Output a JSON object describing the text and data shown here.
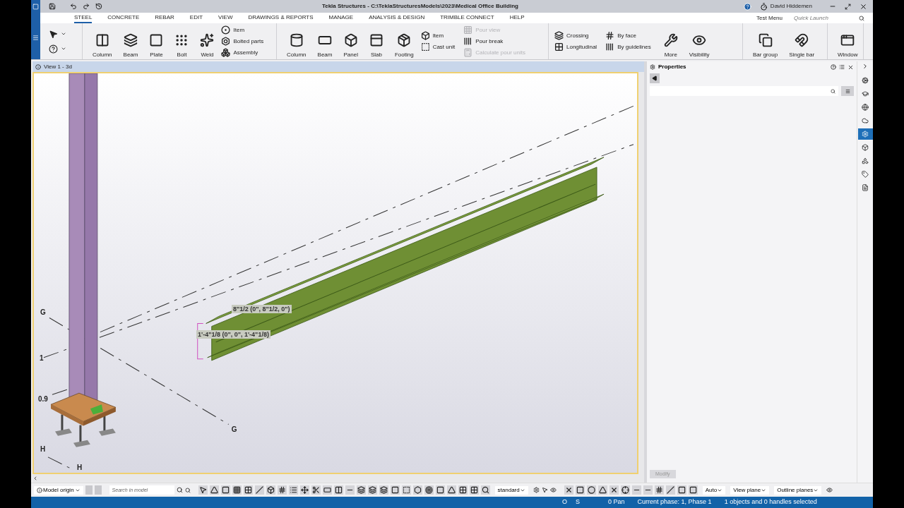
{
  "window": {
    "title": "Tekla Structures - C:\\TeklaStructuresModels\\2023\\Medical Office Building",
    "user": "David Hiddemen"
  },
  "menu_tabs": [
    {
      "label": "STEEL",
      "selected": true
    },
    {
      "label": "CONCRETE",
      "selected": false
    },
    {
      "label": "REBAR",
      "selected": false
    },
    {
      "label": "EDIT",
      "selected": false
    },
    {
      "label": "VIEW",
      "selected": false
    },
    {
      "label": "DRAWINGS & REPORTS",
      "selected": false
    },
    {
      "label": "MANAGE",
      "selected": false
    },
    {
      "label": "ANALYSIS & DESIGN",
      "selected": false
    },
    {
      "label": "TRIMBLE CONNECT",
      "selected": false
    },
    {
      "label": "HELP",
      "selected": false
    }
  ],
  "test_menu": "Test Menu",
  "quick_launch": {
    "placeholder": "Quick Launch"
  },
  "ribbon_groups": [
    {
      "columns": [
        [
          {
            "label": "Column",
            "kind": "large",
            "disabled": false
          }
        ],
        [
          {
            "label": "Beam",
            "kind": "large",
            "disabled": false
          }
        ],
        [
          {
            "label": "Plate",
            "kind": "large",
            "disabled": false
          }
        ],
        [
          {
            "label": "Bolt",
            "kind": "large",
            "disabled": false
          }
        ],
        [
          {
            "label": "Weld",
            "kind": "large",
            "disabled": false
          }
        ],
        [
          {
            "label": "Item",
            "kind": "small",
            "disabled": false
          },
          {
            "label": "Bolted parts",
            "kind": "small",
            "disabled": false
          },
          {
            "label": "Assembly",
            "kind": "small",
            "disabled": false
          }
        ]
      ]
    },
    {
      "columns": [
        [
          {
            "label": "Column",
            "kind": "large",
            "disabled": false
          }
        ],
        [
          {
            "label": "Beam",
            "kind": "large",
            "disabled": false
          }
        ],
        [
          {
            "label": "Panel",
            "kind": "large",
            "disabled": false
          }
        ],
        [
          {
            "label": "Slab",
            "kind": "large",
            "disabled": false
          }
        ],
        [
          {
            "label": "Footing",
            "kind": "large",
            "disabled": false
          }
        ],
        [
          {
            "label": "Item",
            "kind": "small",
            "disabled": false
          },
          {
            "label": "Cast unit",
            "kind": "small",
            "disabled": false
          }
        ],
        [
          {
            "label": "Pour view",
            "kind": "small",
            "disabled": true
          },
          {
            "label": "Pour break",
            "kind": "small",
            "disabled": false
          },
          {
            "label": "Calculate pour units",
            "kind": "small",
            "disabled": true
          }
        ]
      ]
    },
    {
      "columns": [
        [
          {
            "label": "Crossing",
            "kind": "small",
            "disabled": false
          },
          {
            "label": "Longitudinal",
            "kind": "small",
            "disabled": false
          }
        ],
        [
          {
            "label": "By face",
            "kind": "small",
            "disabled": false
          },
          {
            "label": "By guidelines",
            "kind": "small",
            "disabled": false
          }
        ],
        [
          {
            "label": "More",
            "kind": "large",
            "disabled": false
          }
        ],
        [
          {
            "label": "Visibility",
            "kind": "large",
            "disabled": false
          }
        ]
      ]
    },
    {
      "columns": [
        [
          {
            "label": "Bar group",
            "kind": "large",
            "disabled": false
          }
        ],
        [
          {
            "label": "Single bar",
            "kind": "large",
            "disabled": false
          }
        ]
      ]
    },
    {
      "columns": [
        [
          {
            "label": "Window",
            "kind": "large",
            "disabled": false
          }
        ]
      ]
    }
  ],
  "view": {
    "title": "View 1 - 3d",
    "grid_labels": [
      "G",
      "1",
      "0.9",
      "H",
      "H",
      "G"
    ],
    "dimension_labels": [
      "8\"1/2 (0\", 8\"1/2, 0\")",
      "1'-4\"1/8 (0\", 0\", 1'-4\"1/8)"
    ]
  },
  "properties": {
    "title": "Properties",
    "modify_button": {
      "label": "Modify",
      "disabled": true
    }
  },
  "side_tools": [
    {
      "selected": false
    },
    {
      "selected": false
    },
    {
      "selected": false
    },
    {
      "selected": false
    },
    {
      "selected": true
    },
    {
      "selected": false
    },
    {
      "selected": false
    },
    {
      "selected": false
    },
    {
      "selected": false
    }
  ],
  "bottom_toolbar": {
    "origin": "Model origin",
    "search": {
      "placeholder": "Search in model"
    },
    "filter": "standard",
    "dropdowns": [
      "Auto",
      "View plane",
      "Outline planes"
    ]
  },
  "status_bar": [
    "O",
    "S",
    "0 Pan",
    "Current phase: 1, Phase 1",
    "1 objects and 0 handles selected"
  ]
}
